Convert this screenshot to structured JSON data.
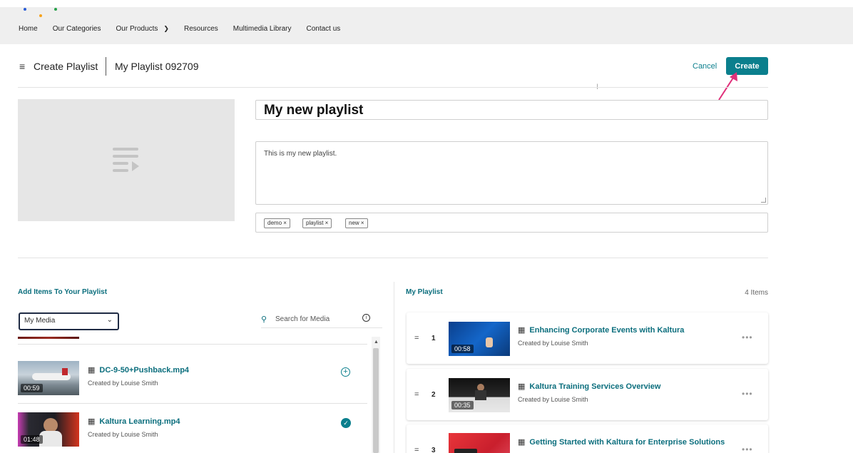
{
  "nav": {
    "items": [
      "Home",
      "Our Categories",
      "Our Products",
      "Resources",
      "Multimedia Library",
      "Contact us"
    ],
    "logo_colors": [
      "#2b5dd6",
      "#f7a21b",
      "#27a04a"
    ]
  },
  "header": {
    "icon": "playlist-icon",
    "title": "Create Playlist",
    "playlist_name": "My Playlist 092709",
    "cancel_label": "Cancel",
    "create_label": "Create"
  },
  "form": {
    "title_value": "My new playlist",
    "description_value": "This is my new playlist.",
    "tags": [
      "demo ×",
      "playlist ×",
      "new ×"
    ]
  },
  "add_panel": {
    "heading": "Add Items To Your Playlist",
    "source_selected": "My Media",
    "search_placeholder": "Search for Media",
    "items": [
      {
        "title": "DC-9-50+Pushback.mp4",
        "creator": "Created by Louise Smith",
        "duration": "00:59",
        "added": false
      },
      {
        "title": "Kaltura Learning.mp4",
        "creator": "Created by Louise Smith",
        "duration": "01:48",
        "added": true
      }
    ]
  },
  "playlist_panel": {
    "heading": "My Playlist",
    "count": "4 Items",
    "items": [
      {
        "index": "1",
        "title": "Enhancing Corporate Events with Kaltura",
        "creator": "Created by Louise Smith",
        "duration": "00:58"
      },
      {
        "index": "2",
        "title": "Kaltura Training Services Overview",
        "creator": "Created by Louise Smith",
        "duration": "00:35"
      },
      {
        "index": "3",
        "title": "Getting Started with Kaltura for Enterprise Solutions",
        "creator": "",
        "duration": ""
      }
    ]
  },
  "colors": {
    "accent": "#0b7f8d",
    "link": "#0b6e7d",
    "annotation_arrow": "#e0307a"
  }
}
